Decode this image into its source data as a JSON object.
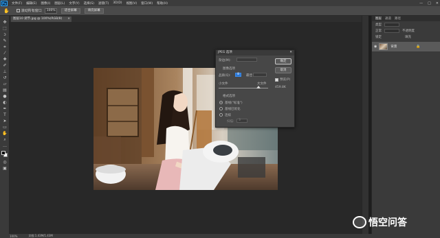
{
  "app": {
    "logo": "Ps",
    "menu": [
      "文件(F)",
      "编辑(E)",
      "图像(I)",
      "图层(L)",
      "文字(Y)",
      "选择(S)",
      "滤镜(T)",
      "3D(D)",
      "视图(V)",
      "窗口(W)",
      "帮助(H)"
    ],
    "window_controls": [
      "—",
      "□",
      "✕"
    ]
  },
  "options_bar": {
    "scroll_all_label": "滚动所有窗口",
    "zoom_value": "100%",
    "fit_screen_label": "适合屏幕",
    "fill_screen_label": "填充屏幕"
  },
  "document": {
    "tab_label": "图层10 调节.jpg @ 100%(RGB/8)",
    "tab_close": "×"
  },
  "status": {
    "zoom": "100%",
    "doc_info": "文档:1.43M/1.43M"
  },
  "panel": {
    "tabs": [
      "图层",
      "通道",
      "路径"
    ],
    "row1_label": "类型",
    "row2_label": "正常",
    "row2_right": "不透明度",
    "row3_label": "锁定",
    "row3_right": "填充",
    "layer_name": "背景"
  },
  "dialog": {
    "title": "JPEG 选项",
    "close": "✕",
    "matte_label": "杂边(M):",
    "image_options_label": "图像选项",
    "quality_label": "品质(Q):",
    "quality_value": "8",
    "quality_level": "最佳",
    "small_file_label": "小文件",
    "large_file_label": "大文件",
    "format_options_label": "格式选项",
    "baseline_standard_label": "基线(\"标准\")",
    "baseline_optimized_label": "基线已优化",
    "progressive_label": "连续",
    "scans_label": "扫描:",
    "scans_value": "3",
    "ok_label": "确定",
    "cancel_label": "取消",
    "preview_label": "预览(P)",
    "file_size": "459.8K",
    "quality_fraction": 0.8
  },
  "watermark": {
    "text": "悟空问答"
  },
  "colors": {
    "menubar": "#3c3c3c",
    "canvas": "#282828",
    "panel": "#3a3a3a",
    "dialog": "#474747"
  }
}
